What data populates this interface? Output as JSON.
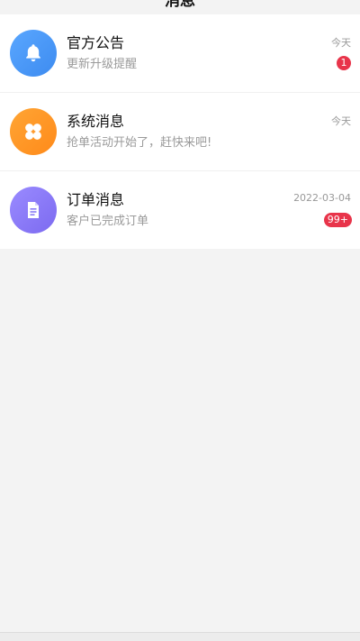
{
  "header": {
    "title": "消息"
  },
  "messages": [
    {
      "icon": "bell-icon",
      "title": "官方公告",
      "subtitle": "更新升级提醒",
      "time": "今天",
      "badge": "1"
    },
    {
      "icon": "clover-icon",
      "title": "系统消息",
      "subtitle": "抢单活动开始了，赶快来吧!",
      "time": "今天",
      "badge": ""
    },
    {
      "icon": "document-icon",
      "title": "订单消息",
      "subtitle": "客户已完成订单",
      "time": "2022-03-04",
      "badge": "99+"
    }
  ],
  "colors": {
    "accent_badge": "#e8344a",
    "notice_icon_bg": "#3d8bf0",
    "system_icon_bg": "#ff8a1a",
    "order_icon_bg": "#7c6af0"
  }
}
